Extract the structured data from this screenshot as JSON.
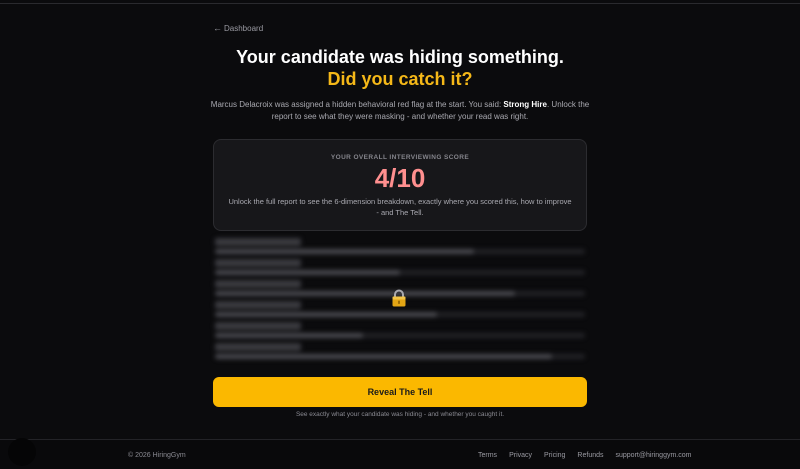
{
  "nav": {
    "back_label": "Dashboard",
    "back_arrow": "←"
  },
  "hero": {
    "headline": "Your candidate was hiding something.",
    "subheadline": "Did you catch it?"
  },
  "intro": {
    "before": "Marcus Delacroix was assigned a hidden behavioral red flag at the start. You said: ",
    "verdict": "Strong Hire",
    "after": ". Unlock the report to see what they were masking - and whether your read was right."
  },
  "score": {
    "label": "YOUR OVERALL INTERVIEWING SCORE",
    "value": "4/10",
    "description": "Unlock the full report to see the 6-dimension breakdown, exactly where you scored this, how to improve - and The Tell."
  },
  "locked_preview": {
    "icon": "lock-icon",
    "rows": [
      {
        "fill": 0.7
      },
      {
        "fill": 0.5
      },
      {
        "fill": 0.81
      },
      {
        "fill": 0.6
      },
      {
        "fill": 0.4
      },
      {
        "fill": 0.91
      }
    ]
  },
  "cta": {
    "button_label": "Reveal The Tell",
    "subtext": "See exactly what your candidate was hiding - and whether you caught it."
  },
  "footer": {
    "copyright": "© 2026 HiringGym",
    "links": [
      "Terms",
      "Privacy",
      "Pricing",
      "Refunds",
      "support@hiringgym.com"
    ]
  },
  "colors": {
    "accent": "#fbb800",
    "score": "#ff8f8f",
    "background": "#0b0b0d"
  }
}
